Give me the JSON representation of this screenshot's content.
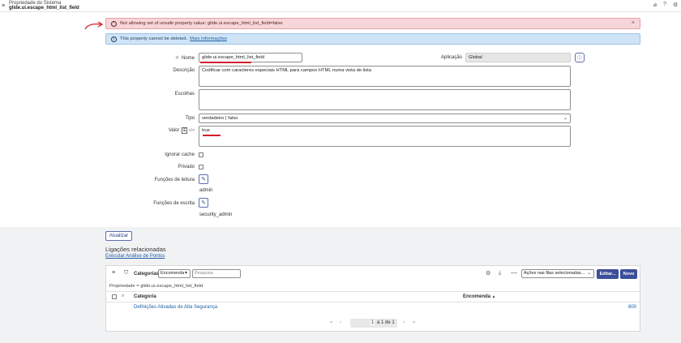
{
  "header": {
    "title_line1": "Propriedade do Sistema",
    "title_line2": "glide.ui.escape_html_list_field",
    "icons": [
      "menu-icon",
      "paperclip-icon",
      "help-icon",
      "settings-icon"
    ]
  },
  "alerts": {
    "error": {
      "text": "Not allowing set of unsafe property value: glide.ui.escape_html_list_field=false",
      "close": "×"
    },
    "info": {
      "text": "This property cannot be deleted.",
      "link": "Mais Informações"
    }
  },
  "form": {
    "name_label": "Nome",
    "name_value": "glide.ui.escape_html_list_field",
    "application_label": "Aplicação",
    "application_value": "Global",
    "description_label": "Descrição",
    "description_value": "Codificar com caracteres especiais HTML para campos HTML numa vista de lista",
    "choices_label": "Escolhas",
    "choices_value": "",
    "type_label": "Tipo",
    "type_value": "verdadeiro | falso",
    "value_label": "Valor",
    "value_value": "true",
    "ignore_cache_label": "Ignorar cache",
    "private_label": "Privado",
    "read_roles_label": "Funções de leitura",
    "read_roles_value": "admin",
    "write_roles_label": "Funções de escrita",
    "write_roles_value": "security_admin"
  },
  "actions": {
    "update_label": "Atualizar"
  },
  "related": {
    "heading": "Ligações relacionadas",
    "run_point_scan": "Executar Análise de Pontos"
  },
  "list": {
    "title": "Categorias",
    "order_select": "Encomenda",
    "search_placeholder": "Pesquisa",
    "actions_select": "Ações nas filas selecionadas...",
    "edit_button": "Editar...",
    "new_button": "Novo",
    "breadcrumb": "Propriedade = glide.ui.escape_html_list_field",
    "columns": [
      "Categoria",
      "Encomenda"
    ],
    "sort_indicator": "▲",
    "rows": [
      {
        "category": "Definições Ativadas de Alta Segurança",
        "order": "800"
      }
    ],
    "pagination": {
      "current": "1",
      "text": "a 1 de 1"
    }
  },
  "colors": {
    "error_bg": "#f6d6d9",
    "info_bg": "#cfe4f6",
    "primary": "#3b4f9a",
    "annotation_red": "#d01f2b"
  }
}
